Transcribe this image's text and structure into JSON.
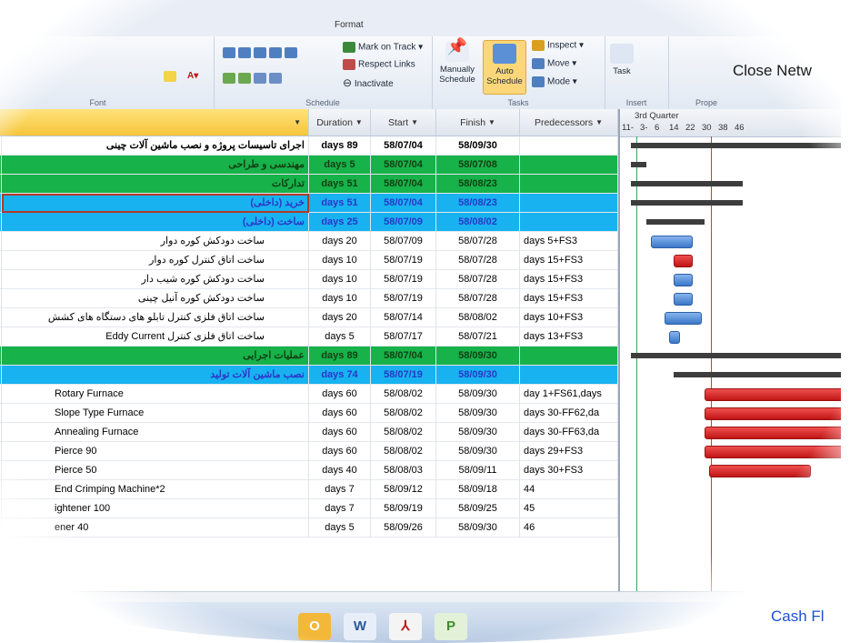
{
  "ribbon": {
    "tabs": [
      "Format"
    ],
    "groups": {
      "font": {
        "label": "Font"
      },
      "schedule": {
        "label": "Schedule",
        "mark_on_track": "Mark on Track",
        "respect_links": "Respect Links",
        "inactivate": "Inactivate",
        "pct": [
          "0x",
          "25x",
          "50x",
          "75x",
          "100x"
        ]
      },
      "tasks": {
        "label": "Tasks",
        "manually": [
          "Manually",
          "Schedule"
        ],
        "auto": [
          "Auto",
          "Schedule"
        ],
        "inspect": "Inspect",
        "move": "Move",
        "mode": "Mode"
      },
      "insert": {
        "label": "Insert",
        "task": "Task"
      },
      "properties": {
        "label": "Prope"
      }
    }
  },
  "overlay": {
    "close_network": "Close Netw",
    "cash_flow": "Cash Fl"
  },
  "table": {
    "columns": [
      "Duration",
      "Start",
      "Finish",
      "Predecessors"
    ],
    "rows": [
      {
        "id": "",
        "name": "اجرای تاسیسات پروژه و نصب ماشین آلات چینی",
        "duration": "days 89",
        "start": "58/07/04",
        "finish": "58/09/30",
        "pred": "",
        "style": "project"
      },
      {
        "id": "",
        "name": "مهندسی و طراحی",
        "duration": "days 5",
        "start": "58/07/04",
        "finish": "58/07/08",
        "pred": "",
        "style": "green"
      },
      {
        "id": "",
        "name": "تدارکات",
        "duration": "days 51",
        "start": "58/07/04",
        "finish": "58/08/23",
        "pred": "",
        "style": "green"
      },
      {
        "id": "0",
        "name": "خرید (داخلی)",
        "duration": "days 51",
        "start": "58/07/04",
        "finish": "58/08/23",
        "pred": "",
        "style": "blue"
      },
      {
        "id": "1",
        "name": "ساخت (داخلی)",
        "duration": "days 25",
        "start": "58/07/09",
        "finish": "58/08/02",
        "pred": "",
        "style": "blue"
      },
      {
        "id": "2",
        "name": "ساخت دودکش کوره دوار",
        "duration": "days 20",
        "start": "58/07/09",
        "finish": "58/07/28",
        "pred": "days 5+FS3",
        "style": "task"
      },
      {
        "id": "3",
        "name": "ساخت اتاق کنترل کوره دوار",
        "duration": "days 10",
        "start": "58/07/19",
        "finish": "58/07/28",
        "pred": "days 15+FS3",
        "style": "task"
      },
      {
        "id": "4",
        "name": "ساخت دودکش کوره شیب دار",
        "duration": "days 10",
        "start": "58/07/19",
        "finish": "58/07/28",
        "pred": "days 15+FS3",
        "style": "task"
      },
      {
        "id": "5",
        "name": "ساخت دودکش کوره آنیل چینی",
        "duration": "days 10",
        "start": "58/07/19",
        "finish": "58/07/28",
        "pred": "days 15+FS3",
        "style": "task"
      },
      {
        "id": "6",
        "name": "ساخت اتاق فلزی کنترل تابلو های دستگاه های کشش",
        "duration": "days 20",
        "start": "58/07/14",
        "finish": "58/08/02",
        "pred": "days 10+FS3",
        "style": "task"
      },
      {
        "id": "7",
        "name": "ساخت اتاق فلزی کنترل Eddy Current",
        "duration": "days 5",
        "start": "58/07/17",
        "finish": "58/07/21",
        "pred": "days 13+FS3",
        "style": "task"
      },
      {
        "id": "8",
        "name": "عملیات اجرایی",
        "duration": "days 89",
        "start": "58/07/04",
        "finish": "58/09/30",
        "pred": "",
        "style": "green"
      },
      {
        "id": "9",
        "name": "نصب ماشین آلات تولید",
        "duration": "days 74",
        "start": "58/07/19",
        "finish": "58/09/30",
        "pred": "",
        "style": "blue"
      },
      {
        "id": "",
        "name": "Rotary Furnace",
        "duration": "days 60",
        "start": "58/08/02",
        "finish": "58/09/30",
        "pred": "day 1+FS61,days",
        "style": "latin"
      },
      {
        "id": "",
        "name": "Slope Type Furnace",
        "duration": "days 60",
        "start": "58/08/02",
        "finish": "58/09/30",
        "pred": "days 30-FF62,da",
        "style": "latin"
      },
      {
        "id": "",
        "name": "Annealing Furnace",
        "duration": "days 60",
        "start": "58/08/02",
        "finish": "58/09/30",
        "pred": "days 30-FF63,da",
        "style": "latin"
      },
      {
        "id": "",
        "name": "Pierce 90",
        "duration": "days 60",
        "start": "58/08/02",
        "finish": "58/09/30",
        "pred": "days 29+FS3",
        "style": "latin"
      },
      {
        "id": "",
        "name": "Pierce 50",
        "duration": "days 40",
        "start": "58/08/03",
        "finish": "58/09/11",
        "pred": "days 30+FS3",
        "style": "latin"
      },
      {
        "id": "",
        "name": "End Crimping Machine*2",
        "duration": "days 7",
        "start": "58/09/12",
        "finish": "58/09/18",
        "pred": "44",
        "style": "latin"
      },
      {
        "id": "",
        "name": "ightener 100",
        "duration": "days 7",
        "start": "58/09/19",
        "finish": "58/09/25",
        "pred": "45",
        "style": "latin"
      },
      {
        "id": "",
        "name": "ener 40",
        "duration": "days 5",
        "start": "58/09/26",
        "finish": "58/09/30",
        "pred": "46",
        "style": "latin"
      }
    ]
  },
  "gantt": {
    "quarter": "3rd Quarter",
    "ticks": [
      "11-",
      "3-",
      "6",
      "14",
      "22",
      "30",
      "38",
      "46"
    ],
    "bars": [
      {
        "kind": "summary",
        "from": 0.05,
        "to": 1.0
      },
      {
        "kind": "summary",
        "from": 0.05,
        "to": 0.12
      },
      {
        "kind": "summary",
        "from": 0.05,
        "to": 0.55
      },
      {
        "kind": "summary",
        "from": 0.05,
        "to": 0.55
      },
      {
        "kind": "summary",
        "from": 0.12,
        "to": 0.38
      },
      {
        "kind": "blue",
        "from": 0.14,
        "to": 0.32
      },
      {
        "kind": "red",
        "from": 0.24,
        "to": 0.32
      },
      {
        "kind": "blue",
        "from": 0.24,
        "to": 0.32
      },
      {
        "kind": "blue",
        "from": 0.24,
        "to": 0.32
      },
      {
        "kind": "blue",
        "from": 0.2,
        "to": 0.36
      },
      {
        "kind": "blue",
        "from": 0.22,
        "to": 0.26
      },
      {
        "kind": "summary",
        "from": 0.05,
        "to": 1.0
      },
      {
        "kind": "summary",
        "from": 0.24,
        "to": 1.0
      },
      {
        "kind": "red",
        "from": 0.38,
        "to": 1.0
      },
      {
        "kind": "red",
        "from": 0.38,
        "to": 1.0
      },
      {
        "kind": "red",
        "from": 0.38,
        "to": 1.0
      },
      {
        "kind": "red",
        "from": 0.38,
        "to": 1.0
      },
      {
        "kind": "red",
        "from": 0.4,
        "to": 0.85
      }
    ]
  },
  "taskbar": {
    "apps": [
      "W",
      "P"
    ]
  },
  "colors": {
    "green": "#17b24a",
    "blue": "#18b2f0",
    "accent": "#f6c53a"
  }
}
